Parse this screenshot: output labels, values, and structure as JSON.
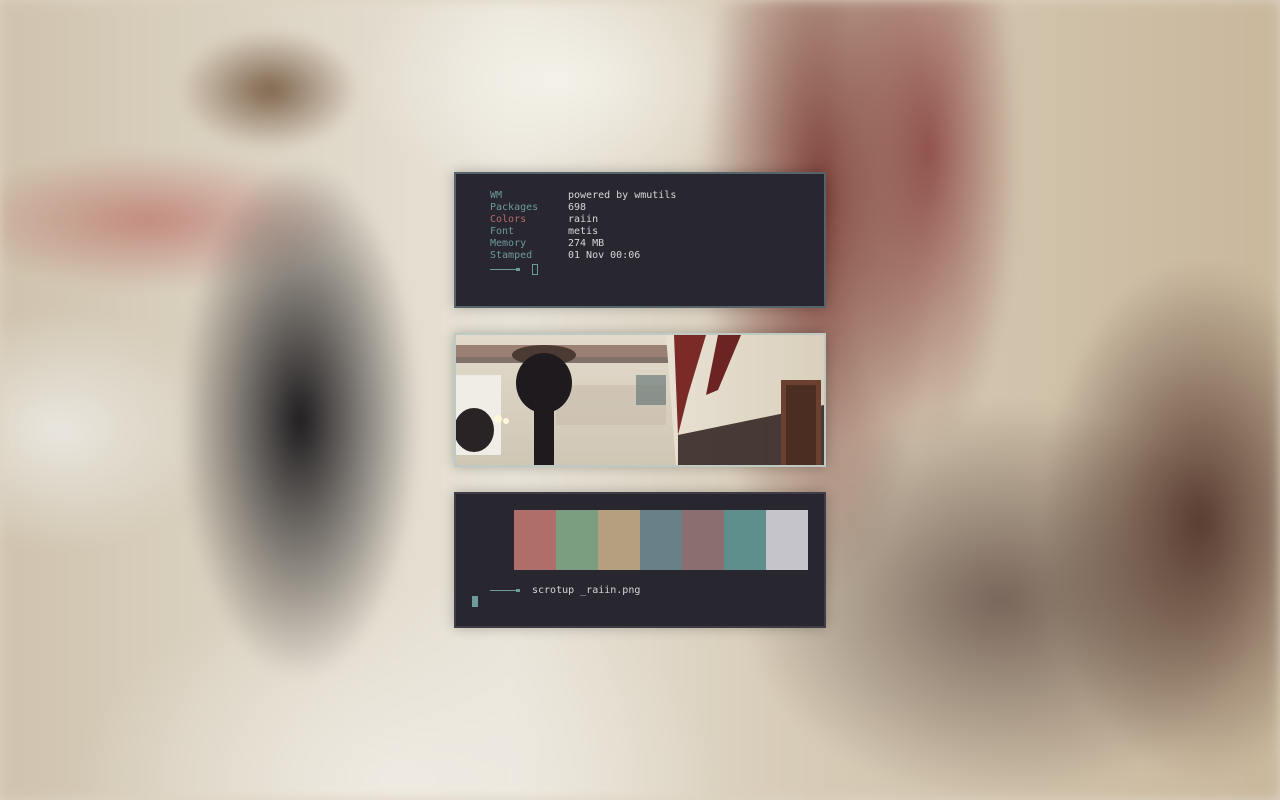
{
  "info": {
    "rows": [
      {
        "key": "WM",
        "value": "powered by wmutils"
      },
      {
        "key": "Packages",
        "value": "698"
      },
      {
        "key": "Colors",
        "value": "raiin"
      },
      {
        "key": "Font",
        "value": "metis"
      },
      {
        "key": "Memory",
        "value": "274 MB"
      },
      {
        "key": "Stamped",
        "value": "01 Nov 00:06"
      }
    ]
  },
  "palette": {
    "colors": [
      "#28262f",
      "#b06e6a",
      "#7b9e80",
      "#b4a07e",
      "#6a8089",
      "#8b6e6f",
      "#5f8f8c",
      "#c6c4cb"
    ]
  },
  "terminal": {
    "command": "scrotup _raiin.png"
  },
  "theme": {
    "accent": "#6e9a9b",
    "key_alt": "#b06e6a",
    "panel_bg": "#28262f",
    "text": "#d8d6dc"
  }
}
